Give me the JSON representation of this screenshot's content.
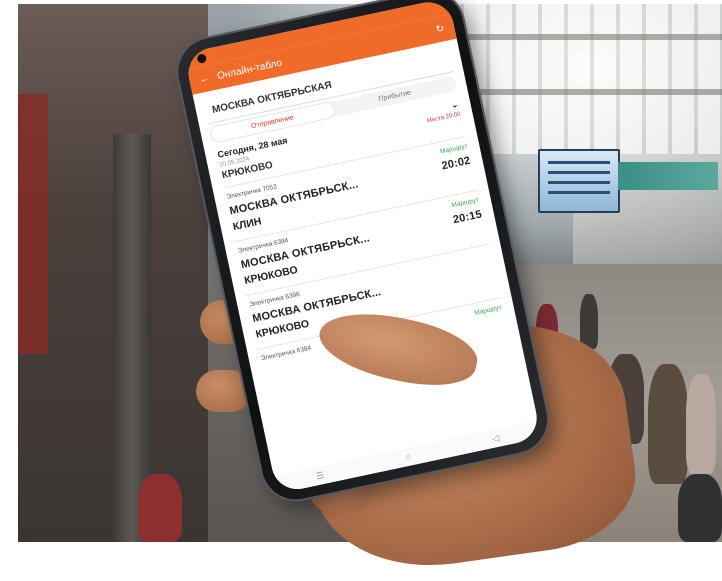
{
  "app": {
    "title": "Онлайн-табло",
    "station": "МОСКВА ОКТЯБРЬСКАЯ",
    "tabs": [
      {
        "label": "Отправление",
        "active": true
      },
      {
        "label": "Прибытие",
        "active": false
      }
    ],
    "date_label": "Сегодня, 28 мая",
    "sub_left": "20.05.2024",
    "sub_right": "Места 20:00",
    "first_destination": "КРЮКОВО",
    "trips": [
      {
        "train": "Электричка 7053",
        "status": "Маршрут",
        "from": "МОСКВА ОКТЯБРЬСК...",
        "time": "20:02",
        "to": "КЛИН"
      },
      {
        "train": "Электричка 6394",
        "status": "Маршрут",
        "from": "МОСКВА ОКТЯБРЬСК...",
        "time": "20:15",
        "to": "КРЮКОВО"
      },
      {
        "train": "Электричка 6396",
        "status": "",
        "from": "МОСКВА ОКТЯБРЬСК...",
        "time": "",
        "to": "КРЮКОВО"
      },
      {
        "train": "Электричка 6384",
        "status": "Маршрут",
        "from": "",
        "time": "",
        "to": ""
      }
    ]
  },
  "colors": {
    "accent": "#f06a2a",
    "on_time": "#3aa85a",
    "active_tab": "#e23b2e"
  },
  "icons": {
    "back": "arrow-left-icon",
    "refresh": "refresh-icon"
  }
}
